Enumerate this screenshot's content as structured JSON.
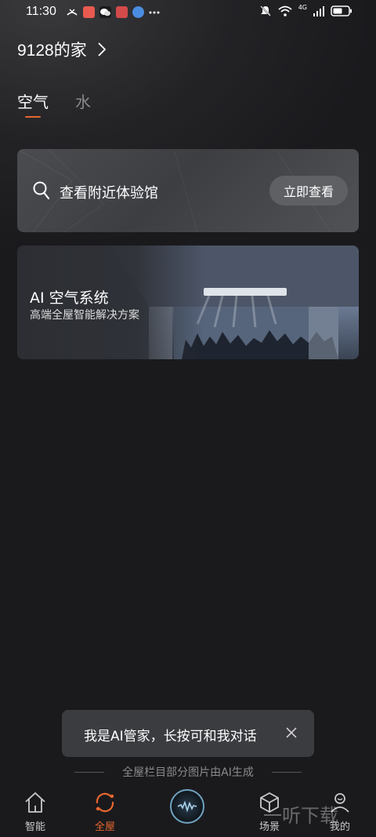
{
  "status_bar": {
    "time": "11:30",
    "network_label": "4G"
  },
  "home": {
    "title": "9128的家"
  },
  "tabs": [
    {
      "label": "空气",
      "active": true
    },
    {
      "label": "水",
      "active": false
    }
  ],
  "search_card": {
    "text": "查看附近体验馆",
    "button_label": "立即查看"
  },
  "ai_card": {
    "title": "AI 空气系统",
    "subtitle": "高端全屋智能解决方案"
  },
  "toast": {
    "text": "我是AI管家，长按可和我对话"
  },
  "ai_note": "全屋栏目部分图片由AI生成",
  "bottom_nav": [
    {
      "label": "智能",
      "icon": "home-icon",
      "active": false
    },
    {
      "label": "全屋",
      "icon": "refresh-icon",
      "active": true
    },
    {
      "label": "",
      "icon": "voice-assistant-icon",
      "active": false
    },
    {
      "label": "场景",
      "icon": "cube-icon",
      "active": false
    },
    {
      "label": "我的",
      "icon": "user-icon",
      "active": false
    }
  ],
  "watermark": "一听下载",
  "colors": {
    "accent": "#e8672e",
    "background": "#1a1a1d",
    "card": "#3c3e42"
  }
}
